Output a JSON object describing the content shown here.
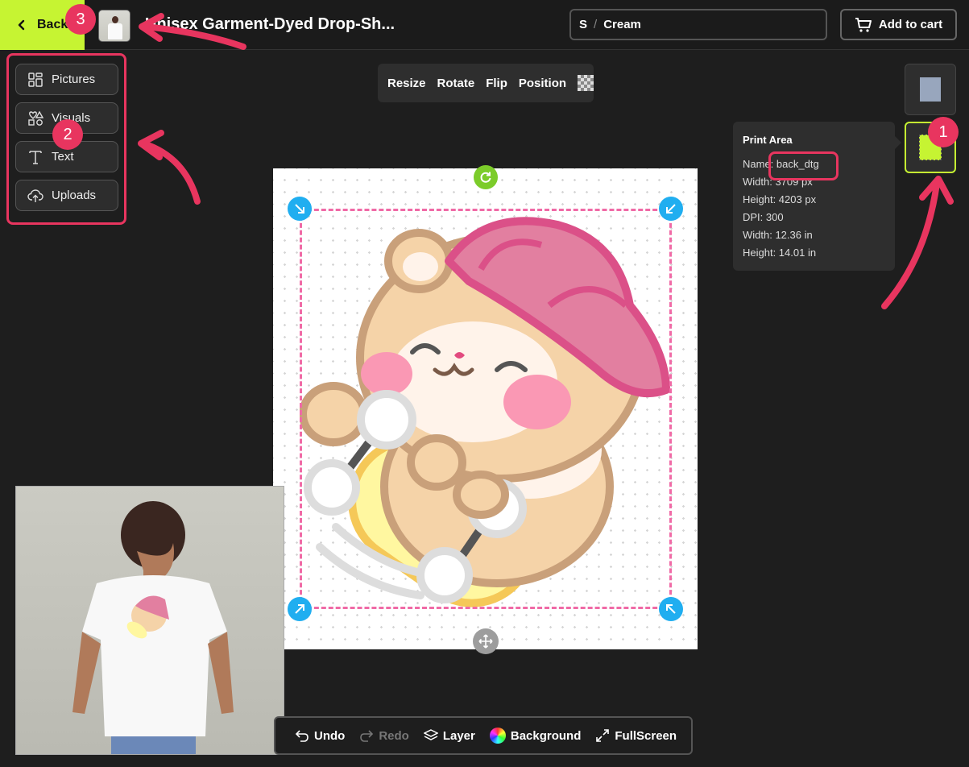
{
  "header": {
    "back_label": "Back",
    "product_title": "Unisex Garment-Dyed Drop-Sh...",
    "variant_size": "S",
    "variant_separator": "/",
    "variant_color": "Cream",
    "cart_label": "Add to cart"
  },
  "tools": {
    "items": [
      {
        "label": "Pictures",
        "icon": "grid-icon"
      },
      {
        "label": "Visuals",
        "icon": "shapes-icon"
      },
      {
        "label": "Text",
        "icon": "text-icon"
      },
      {
        "label": "Uploads",
        "icon": "cloud-upload-icon"
      }
    ]
  },
  "edit_toolbar": {
    "resize": "Resize",
    "rotate": "Rotate",
    "flip": "Flip",
    "position": "Position"
  },
  "print_area": {
    "title": "Print Area",
    "name_label": "Name:",
    "name_value": "back_dtg",
    "width_px": "Width: 3709 px",
    "height_px": "Height: 4203 px",
    "dpi": "DPI: 300",
    "width_in": "Width: 12.36 in",
    "height_in": "Height: 14.01 in"
  },
  "bottom_bar": {
    "undo": "Undo",
    "redo": "Redo",
    "layer": "Layer",
    "background": "Background",
    "fullscreen": "FullScreen"
  },
  "annotations": {
    "badge1": "1",
    "badge2": "2",
    "badge3": "3"
  },
  "colors": {
    "accent": "#c6f432",
    "annotation": "#e8355f",
    "handle_blue": "#20aef0",
    "dashed_border": "#f06aa6"
  }
}
